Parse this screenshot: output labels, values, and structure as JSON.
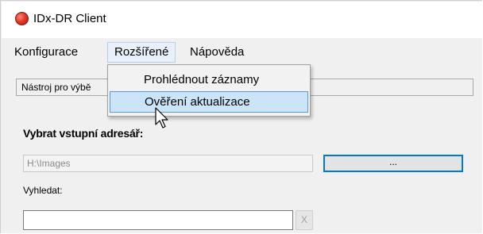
{
  "window": {
    "title": "IDx-DR Client"
  },
  "menubar": {
    "items": [
      {
        "label": "Konfigurace"
      },
      {
        "label": "Rozšířené"
      },
      {
        "label": "Nápověda"
      }
    ]
  },
  "dropdown": {
    "items": [
      {
        "label": "Prohlédnout záznamy"
      },
      {
        "label": "Ověření aktualizace",
        "highlighted": true
      }
    ]
  },
  "toolbar": {
    "label": "Nástroj pro výbě"
  },
  "input_section": {
    "label": "Vybrat vstupní adresář:",
    "path_value": "H:\\Images",
    "browse_label": "..."
  },
  "search": {
    "label": "Vyhledat:",
    "value": "",
    "clear_label": "X"
  },
  "icons": {
    "app": "app-logo-icon",
    "pointer": "mouse-pointer-icon"
  },
  "colors": {
    "highlight_bg": "#cce4f7",
    "highlight_border": "#5b9bd5",
    "focus_border": "#0078d7",
    "app_icon_red": "#e53a2a"
  }
}
